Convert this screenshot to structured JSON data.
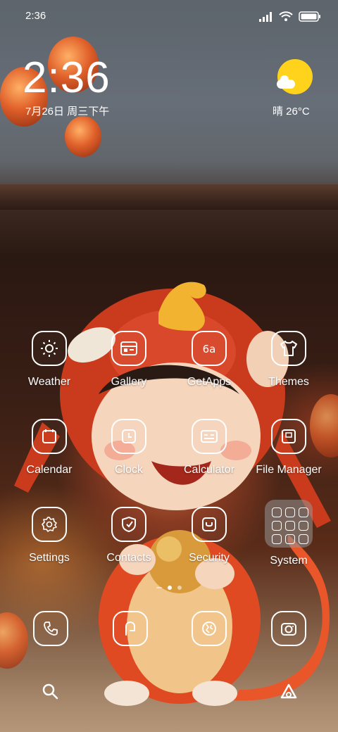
{
  "status_bar": {
    "time": "2:36"
  },
  "clock_widget": {
    "time": "2:36",
    "date": "7月26日 周三下午"
  },
  "weather_widget": {
    "text": "晴 26°C",
    "icon": "sun-cloud-icon",
    "sun_color": "#ffd31c"
  },
  "apps": [
    {
      "label": "Weather",
      "icon": "sun-icon"
    },
    {
      "label": "Gallery",
      "icon": "gallery-icon"
    },
    {
      "label": "GetApps",
      "icon": "getapps-icon"
    },
    {
      "label": "Themes",
      "icon": "shirt-icon"
    },
    {
      "label": "Calendar",
      "icon": "calendar-icon"
    },
    {
      "label": "Clock",
      "icon": "clock-icon"
    },
    {
      "label": "Calculator",
      "icon": "calculator-icon"
    },
    {
      "label": "File Manager",
      "icon": "folder-icon"
    },
    {
      "label": "Settings",
      "icon": "gear-icon"
    },
    {
      "label": "Contacts",
      "icon": "contacts-icon"
    },
    {
      "label": "Security",
      "icon": "shield-icon"
    },
    {
      "label": "System",
      "icon": "folder-grid-icon"
    }
  ],
  "dock": [
    {
      "name": "phone",
      "icon": "phone-icon"
    },
    {
      "name": "messages",
      "icon": "message-icon"
    },
    {
      "name": "browser",
      "icon": "browser-icon"
    },
    {
      "name": "camera",
      "icon": "camera-icon"
    }
  ],
  "page_indicator": {
    "pages": 3,
    "active": 2
  },
  "bottom_bar": {
    "left_icon": "search-icon",
    "right_icon": "app-vault-icon"
  }
}
